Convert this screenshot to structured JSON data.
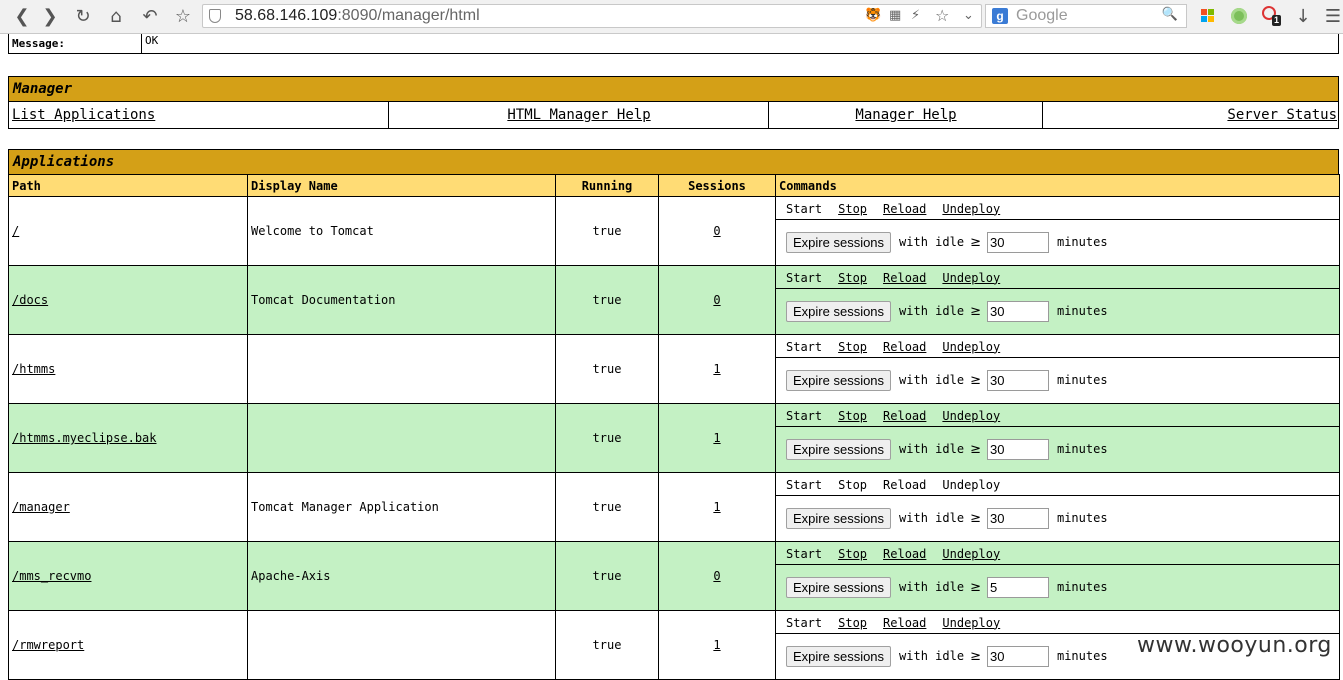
{
  "browser": {
    "url_host": "58.68.146.109",
    "url_rest": ":8090/manager/html",
    "search_placeholder": "Google",
    "badge_count": "1"
  },
  "message": {
    "label": "Message:",
    "value": "OK"
  },
  "manager": {
    "title": "Manager",
    "links": [
      "List Applications",
      "HTML Manager Help",
      "Manager Help",
      "Server Status"
    ]
  },
  "applications": {
    "title": "Applications",
    "headers": {
      "path": "Path",
      "display_name": "Display Name",
      "running": "Running",
      "sessions": "Sessions",
      "commands": "Commands"
    },
    "commands": {
      "start": "Start",
      "stop": "Stop",
      "reload": "Reload",
      "undeploy": "Undeploy",
      "expire": "Expire sessions",
      "with_idle": "with idle",
      "gte": "≥",
      "minutes": "minutes"
    },
    "rows": [
      {
        "path": "/",
        "display_name": "Welcome to Tomcat",
        "running": "true",
        "sessions": "0",
        "idle": "30"
      },
      {
        "path": "/docs",
        "display_name": "Tomcat Documentation",
        "running": "true",
        "sessions": "0",
        "idle": "30"
      },
      {
        "path": "/htmms",
        "display_name": "",
        "running": "true",
        "sessions": "1",
        "idle": "30"
      },
      {
        "path": "/htmms.myeclipse.bak",
        "display_name": "",
        "running": "true",
        "sessions": "1",
        "idle": "30"
      },
      {
        "path": "/manager",
        "display_name": "Tomcat Manager Application",
        "running": "true",
        "sessions": "1",
        "idle": "30"
      },
      {
        "path": "/mms_recvmo",
        "display_name": "Apache-Axis",
        "running": "true",
        "sessions": "0",
        "idle": "5"
      },
      {
        "path": "/rmwreport",
        "display_name": "",
        "running": "true",
        "sessions": "1",
        "idle": "30"
      }
    ]
  },
  "watermark": "www.wooyun.org"
}
